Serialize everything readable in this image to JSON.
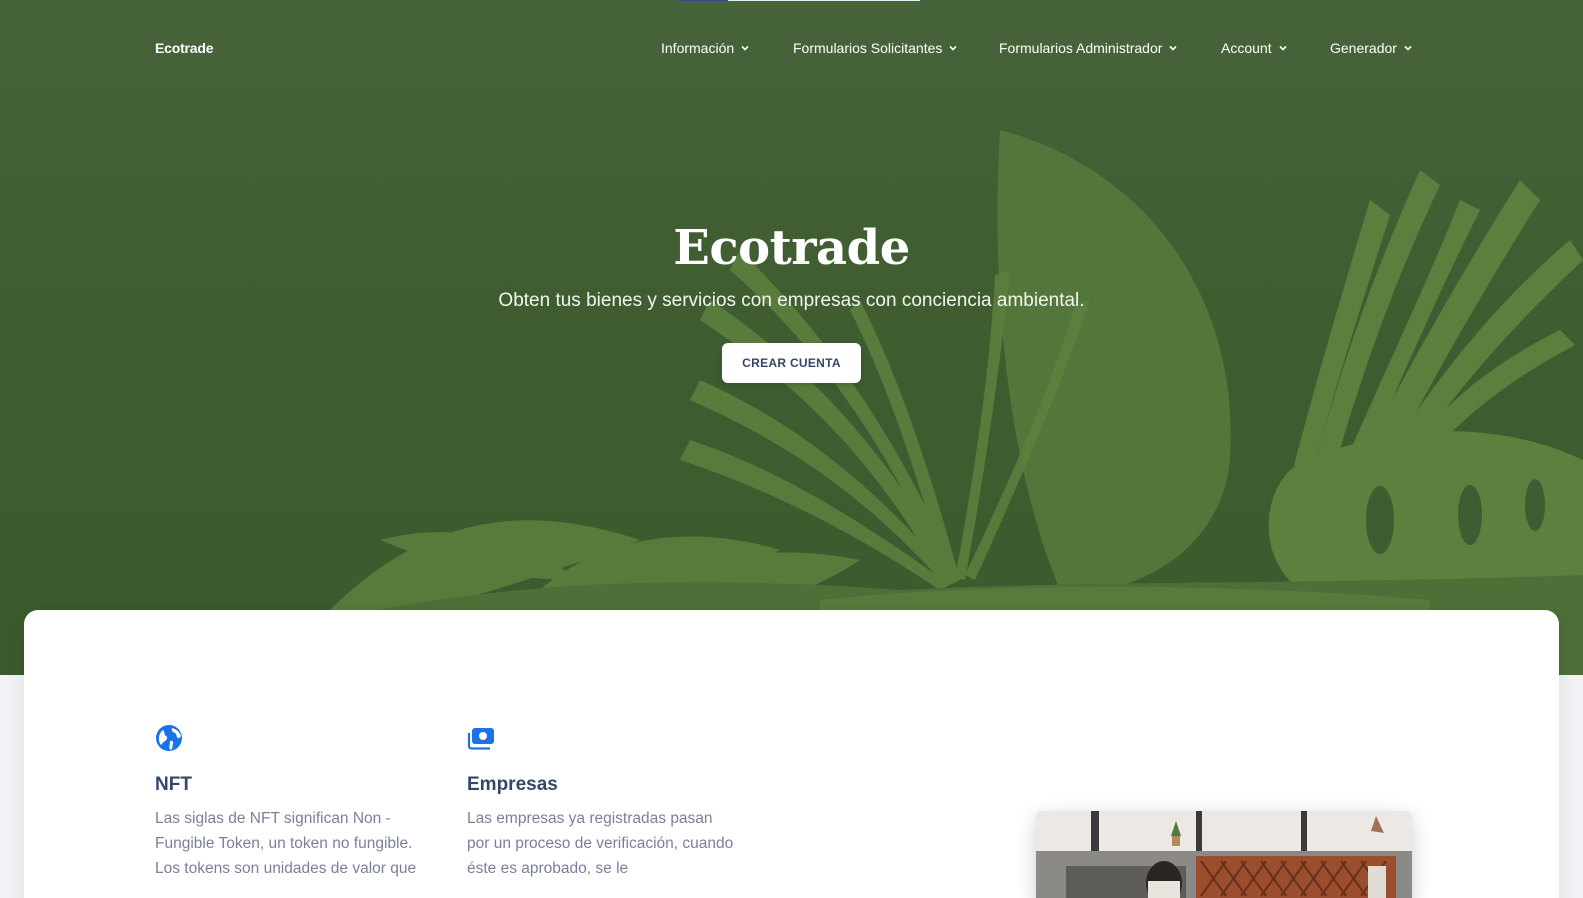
{
  "nav": {
    "brand": "Ecotrade",
    "items": [
      {
        "label": "Información"
      },
      {
        "label": "Formularios Solicitantes"
      },
      {
        "label": "Formularios Administrador"
      },
      {
        "label": "Account"
      },
      {
        "label": "Generador"
      }
    ]
  },
  "hero": {
    "title": "Ecotrade",
    "subtitle": "Obten tus bienes y servicios con empresas con conciencia ambiental.",
    "cta_label": "CREAR CUENTA"
  },
  "features": [
    {
      "icon": "globe-icon",
      "title": "NFT",
      "text": "Las siglas de NFT significan Non - Fungible Token, un token no fungible. Los tokens son unidades de valor que"
    },
    {
      "icon": "money-icon",
      "title": "Empresas",
      "text": "Las empresas ya registradas pasan por un proceso de verificación, cuando éste es aprobado, se le"
    }
  ],
  "colors": {
    "hero_bg": "#3f5d31",
    "leaf_dark": "#4f6e38",
    "leaf_light": "#6a8a45",
    "icon_blue": "#1a73e8",
    "heading": "#344767",
    "body_text": "#7b809a"
  }
}
